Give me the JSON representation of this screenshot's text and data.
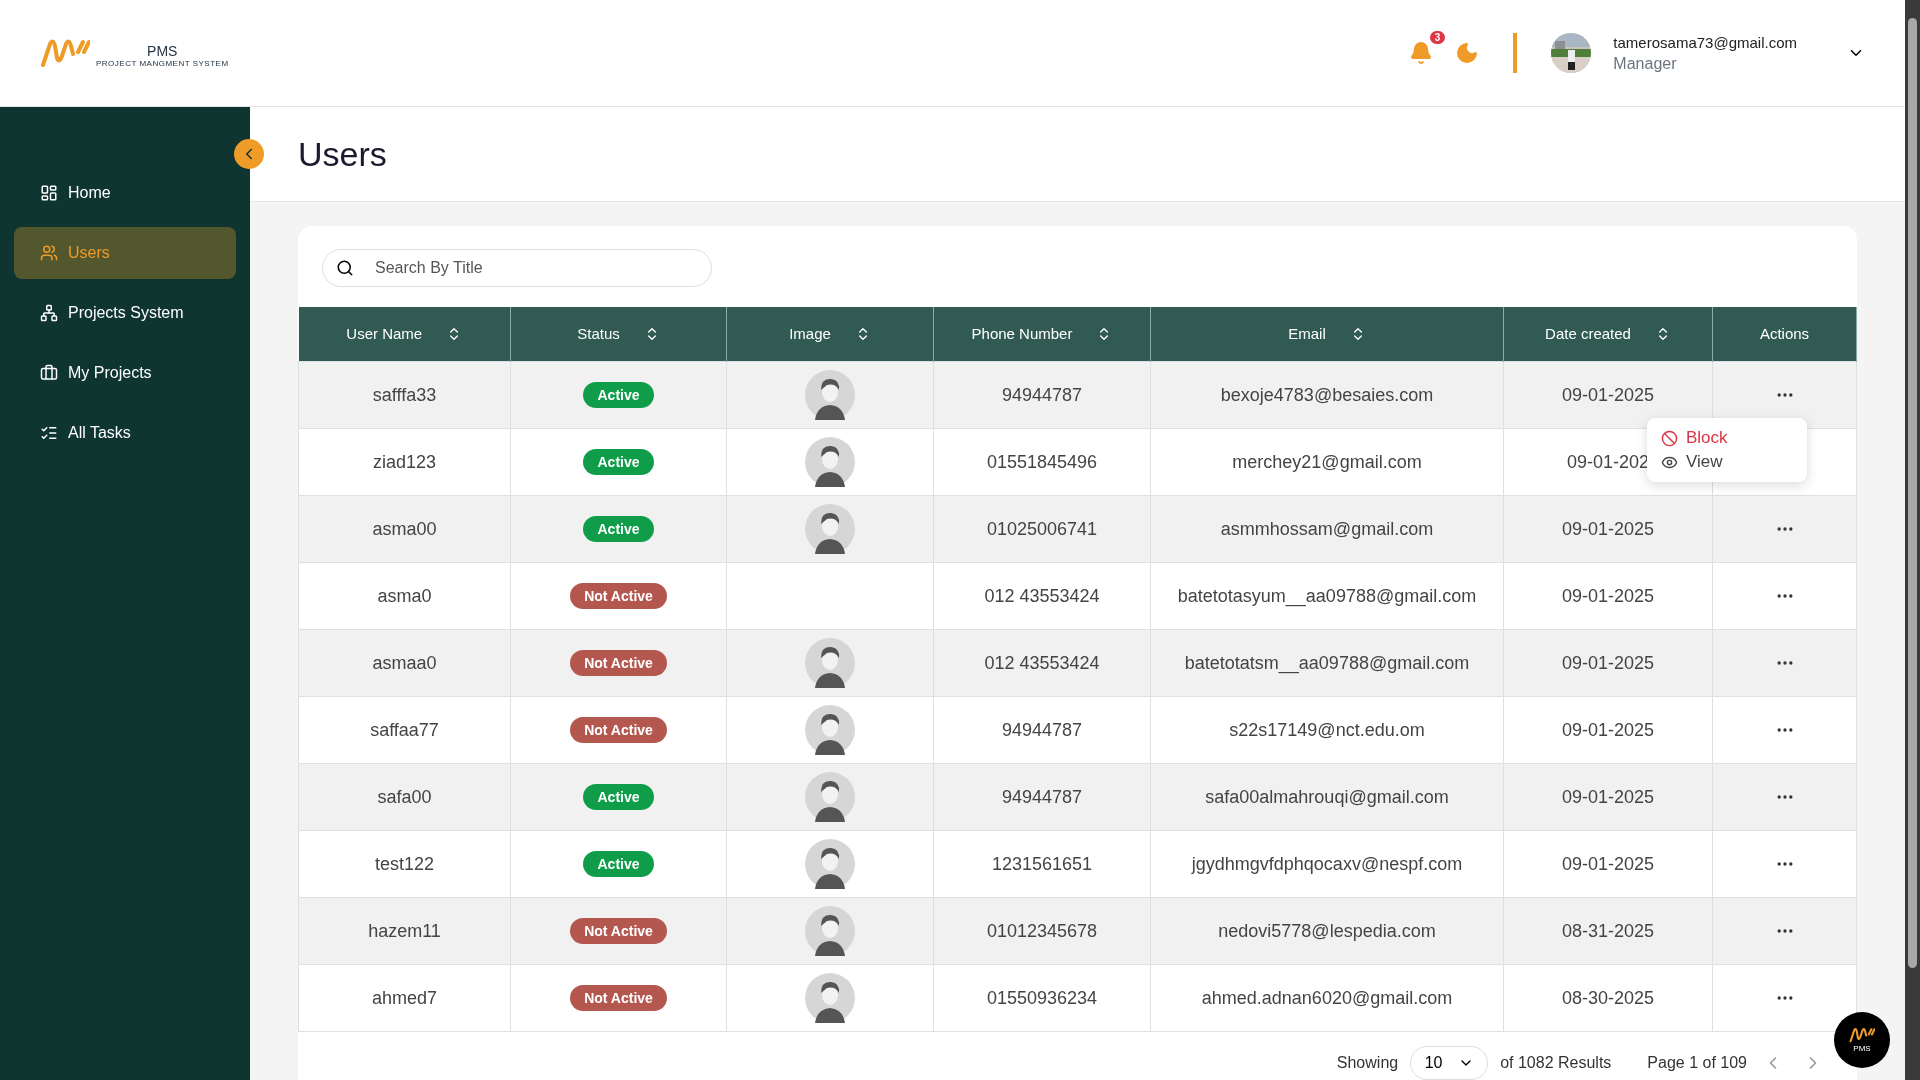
{
  "logo": {
    "name": "PMS",
    "subtitle": "PROJECT MANGMENT SYSTEM"
  },
  "header": {
    "notifications": "3",
    "user": {
      "email": "tamerosama73@gmail.com",
      "role": "Manager"
    }
  },
  "sidebar": {
    "items": [
      {
        "label": "Home",
        "selected": false
      },
      {
        "label": "Users",
        "selected": true
      },
      {
        "label": "Projects System",
        "selected": false
      },
      {
        "label": "My Projects",
        "selected": false
      },
      {
        "label": "All Tasks",
        "selected": false
      }
    ]
  },
  "page": {
    "title": "Users"
  },
  "search": {
    "placeholder": "Search By Title"
  },
  "table": {
    "columns": [
      {
        "label": "User Name",
        "sortable": true
      },
      {
        "label": "Status",
        "sortable": true
      },
      {
        "label": "Image",
        "sortable": true
      },
      {
        "label": "Phone Number",
        "sortable": true
      },
      {
        "label": "Email",
        "sortable": true
      },
      {
        "label": "Date created",
        "sortable": true
      },
      {
        "label": "Actions",
        "sortable": false
      }
    ],
    "rows": [
      {
        "user_name": "safffa33",
        "status": "Active",
        "active": true,
        "has_image": true,
        "phone": "94944787",
        "email": "bexoje4783@besaies.com",
        "date": "09-01-2025",
        "menu_open": true
      },
      {
        "user_name": "ziad123",
        "status": "Active",
        "active": true,
        "has_image": true,
        "phone": "01551845496",
        "email": "merchey21@gmail.com",
        "date": "09-01-202",
        "menu_open": false
      },
      {
        "user_name": "asma00",
        "status": "Active",
        "active": true,
        "has_image": true,
        "phone": "01025006741",
        "email": "asmmhossam@gmail.com",
        "date": "09-01-2025",
        "menu_open": false
      },
      {
        "user_name": "asma0",
        "status": "Not Active",
        "active": false,
        "has_image": false,
        "phone": "012 43553424",
        "email": "batetotasyum__aa09788@gmail.com",
        "date": "09-01-2025",
        "menu_open": false
      },
      {
        "user_name": "asmaa0",
        "status": "Not Active",
        "active": false,
        "has_image": true,
        "phone": "012 43553424",
        "email": "batetotatsm__aa09788@gmail.com",
        "date": "09-01-2025",
        "menu_open": false
      },
      {
        "user_name": "saffaa77",
        "status": "Not Active",
        "active": false,
        "has_image": true,
        "phone": "94944787",
        "email": "s22s17149@nct.edu.om",
        "date": "09-01-2025",
        "menu_open": false
      },
      {
        "user_name": "safa00",
        "status": "Active",
        "active": true,
        "has_image": true,
        "phone": "94944787",
        "email": "safa00almahrouqi@gmail.com",
        "date": "09-01-2025",
        "menu_open": false
      },
      {
        "user_name": "test122",
        "status": "Active",
        "active": true,
        "has_image": true,
        "phone": "1231561651",
        "email": "jgydhmgvfdphqocaxv@nespf.com",
        "date": "09-01-2025",
        "menu_open": false
      },
      {
        "user_name": "hazem11",
        "status": "Not Active",
        "active": false,
        "has_image": true,
        "phone": "01012345678",
        "email": "nedovi5778@lespedia.com",
        "date": "08-31-2025",
        "menu_open": false
      },
      {
        "user_name": "ahmed7",
        "status": "Not Active",
        "active": false,
        "has_image": true,
        "phone": "01550936234",
        "email": "ahmed.adnan6020@gmail.com",
        "date": "08-30-2025",
        "menu_open": false
      }
    ]
  },
  "action_menu": [
    {
      "label": "Block",
      "kind": "danger"
    },
    {
      "label": "View",
      "kind": "normal"
    }
  ],
  "pagination": {
    "showing": "Showing",
    "page_size": "10",
    "results": "of 1082 Results",
    "page": "Page 1 of 109"
  },
  "fab": {
    "label": "PMS"
  }
}
